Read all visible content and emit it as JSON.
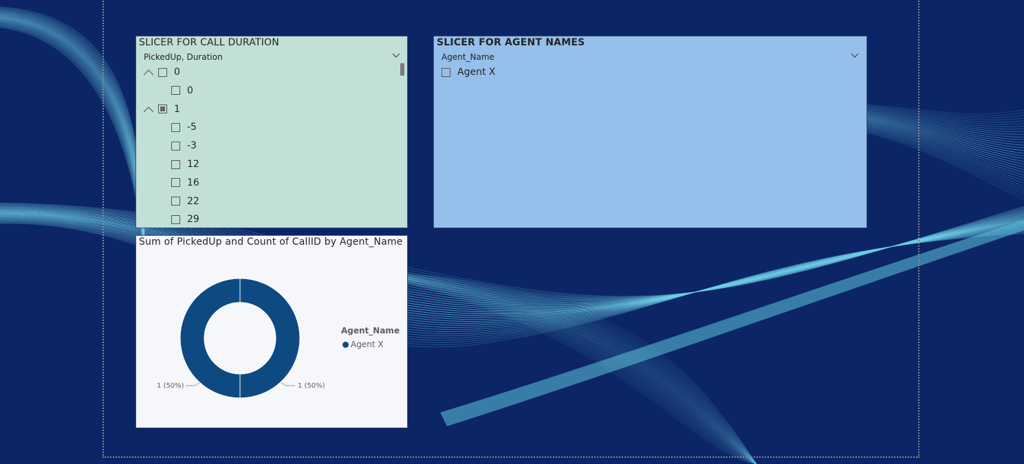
{
  "slicer_duration": {
    "title": "SLICER FOR CALL DURATION",
    "header": "PickedUp, Duration",
    "items": [
      {
        "label": "0",
        "level": 0,
        "state": "unchecked"
      },
      {
        "label": "0",
        "level": 1,
        "state": "unchecked"
      },
      {
        "label": "1",
        "level": 0,
        "state": "partial"
      },
      {
        "label": "-5",
        "level": 1,
        "state": "unchecked"
      },
      {
        "label": "-3",
        "level": 1,
        "state": "unchecked"
      },
      {
        "label": "12",
        "level": 1,
        "state": "unchecked"
      },
      {
        "label": "16",
        "level": 1,
        "state": "unchecked"
      },
      {
        "label": "22",
        "level": 1,
        "state": "unchecked"
      },
      {
        "label": "29",
        "level": 1,
        "state": "unchecked"
      }
    ]
  },
  "slicer_agent": {
    "title": "SLICER FOR AGENT NAMES",
    "header": "Agent_Name",
    "items": [
      {
        "label": "Agent X",
        "state": "unchecked"
      }
    ]
  },
  "chart": {
    "title": "Sum of PickedUp and Count of CallID by Agent_Name",
    "legend_title": "Agent_Name",
    "legend_items": [
      "Agent X"
    ],
    "color": "#0e4a82",
    "label_left": "1 (50%)",
    "label_right": "1 (50%)"
  },
  "chart_data": {
    "type": "pie",
    "title": "Sum of PickedUp and Count of CallID by Agent_Name",
    "legend_title": "Agent_Name",
    "categories": [
      "Agent X",
      "Agent X"
    ],
    "values": [
      1,
      1
    ],
    "labels": [
      "1 (50%)",
      "1 (50%)"
    ],
    "donut": true,
    "legend_placement": "right"
  }
}
